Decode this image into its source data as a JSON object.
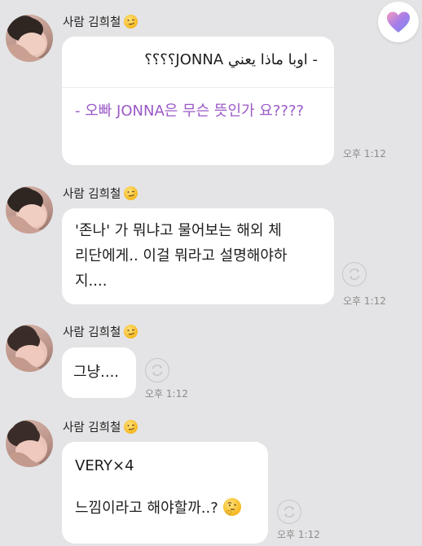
{
  "favorite_button": {
    "icon": "heart-gradient-icon",
    "colors": [
      "#f79bc0",
      "#a67ce8",
      "#7b8cf0"
    ]
  },
  "messages": [
    {
      "sender": "사람 김희철",
      "sender_emoji": "smirk-emoji-icon",
      "lines_original": "- اوبا ماذا يعني JONNA؟؟؟؟",
      "lines_translated": "- 오빠 JONNA은 무슨 뜻인가 요????",
      "time": "오후 1:12"
    },
    {
      "sender": "사람 김희철",
      "sender_emoji": "smirk-emoji-icon",
      "text_line1": "'존나' 가 뭐냐고 물어보는 해외 체",
      "text_line2": "리단에게.. 이걸 뭐라고 설명해야하",
      "text_line3": "지....",
      "time": "오후 1:12"
    },
    {
      "sender": "사람 김희철",
      "sender_emoji": "smirk-emoji-icon",
      "text": "그냥....",
      "time": "오후 1:12"
    },
    {
      "sender": "사람 김희철",
      "sender_emoji": "smirk-emoji-icon",
      "text_line1": "VERY×4",
      "text_line2": "느낌이라고 해야할까..?",
      "trailing_emoji": "thinking-face-emoji-icon",
      "time": "오후 1:12"
    }
  ],
  "colors": {
    "background": "#e4e4e6",
    "bubble": "#ffffff",
    "translated_text": "#9b59c6",
    "timestamp": "#8b8b8b"
  }
}
